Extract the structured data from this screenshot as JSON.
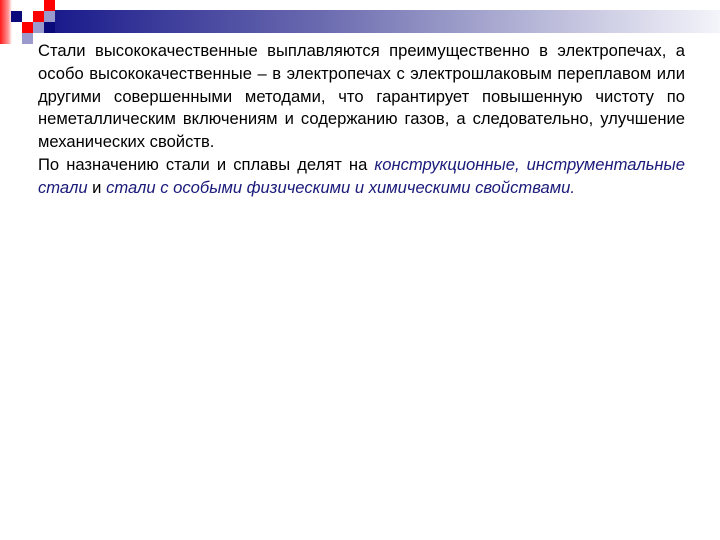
{
  "slide": {
    "paragraph1": "Стали высококачественные выплавляются преимущественно в электропечах, а особо высококачественные – в электропечах с электрошлаковым переплавом или другими совершенными методами, что гарантирует повышенную чистоту по неметаллическим включениям и содержанию газов, а следовательно, улучшение механических свойств.",
    "paragraph2": {
      "intro": "По назначению стали и сплавы делят на ",
      "term1": "конструкционные, инструментальные стали",
      "connector": " и ",
      "term2": "стали с особыми физическими и химическими свойствами",
      "end": "."
    }
  },
  "colors": {
    "banner_start": "#1a1a8c",
    "accent_red": "#ff0000",
    "emphasis_text": "#1a1a7a"
  }
}
